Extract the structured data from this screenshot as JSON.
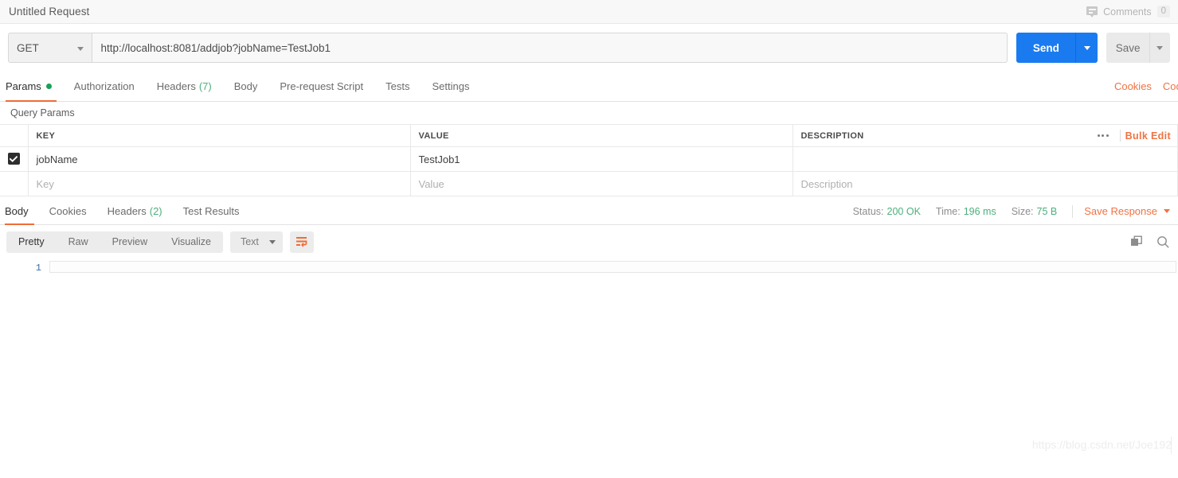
{
  "titlebar": {
    "request_title": "Untitled Request",
    "comments_label": "Comments",
    "comments_count": "0"
  },
  "urlbar": {
    "method": "GET",
    "url": "http://localhost:8081/addjob?jobName=TestJob1",
    "send_label": "Send",
    "save_label": "Save"
  },
  "request_tabs": {
    "items": [
      {
        "label": "Params",
        "badge": "",
        "dot": true
      },
      {
        "label": "Authorization",
        "badge": "",
        "dot": false
      },
      {
        "label": "Headers",
        "badge": "(7)",
        "dot": false
      },
      {
        "label": "Body",
        "badge": "",
        "dot": false
      },
      {
        "label": "Pre-request Script",
        "badge": "",
        "dot": false
      },
      {
        "label": "Tests",
        "badge": "",
        "dot": false
      },
      {
        "label": "Settings",
        "badge": "",
        "dot": false
      }
    ],
    "cookies_link": "Cookies",
    "code_link": "Code"
  },
  "params": {
    "section_label": "Query Params",
    "columns": [
      "KEY",
      "VALUE",
      "DESCRIPTION"
    ],
    "bulk_edit_label": "Bulk Edit",
    "rows": [
      {
        "checked": true,
        "key": "jobName",
        "value": "TestJob1",
        "description": ""
      }
    ],
    "placeholders": {
      "key": "Key",
      "value": "Value",
      "description": "Description"
    }
  },
  "response_tabs": {
    "items": [
      {
        "label": "Body",
        "badge": ""
      },
      {
        "label": "Cookies",
        "badge": ""
      },
      {
        "label": "Headers",
        "badge": "(2)"
      },
      {
        "label": "Test Results",
        "badge": ""
      }
    ],
    "status_label": "Status:",
    "status_value": "200 OK",
    "time_label": "Time:",
    "time_value": "196 ms",
    "size_label": "Size:",
    "size_value": "75 B",
    "save_response_label": "Save Response"
  },
  "response_toolbar": {
    "views": [
      "Pretty",
      "Raw",
      "Preview",
      "Visualize"
    ],
    "active_view": "Pretty",
    "format": "Text"
  },
  "response_body": {
    "lines": [
      {
        "number": "1",
        "text": ""
      }
    ]
  },
  "watermark": "https://blog.csdn.net/Joe192",
  "colors": {
    "accent_orange": "#f07243",
    "send_blue": "#1a7bf0",
    "status_green": "#4caf7d",
    "param_dot_green": "#18a157"
  }
}
